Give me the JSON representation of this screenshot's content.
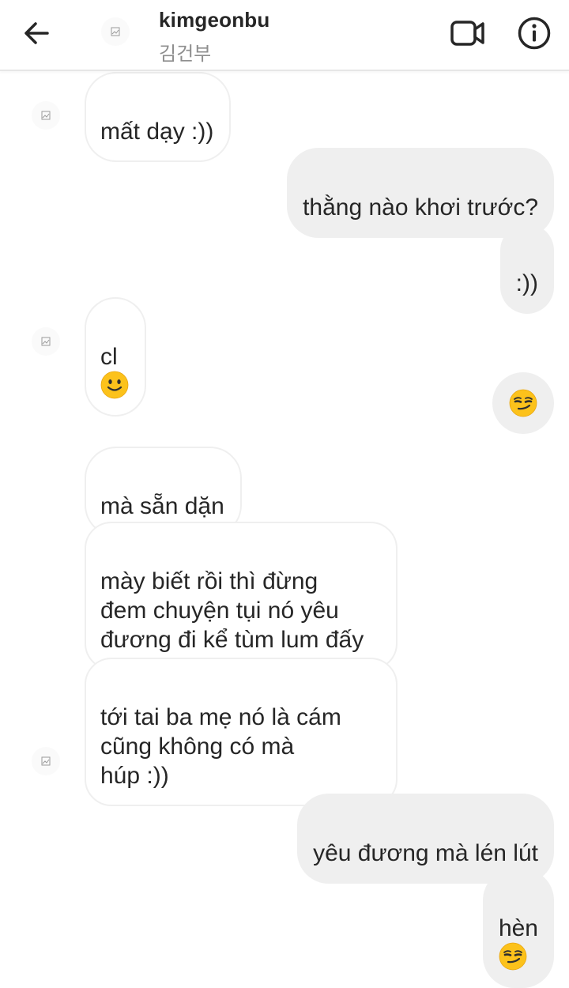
{
  "header": {
    "username": "kimgeonbu",
    "fullname": "김건부",
    "back_icon": "arrow-left-icon",
    "video_icon": "video-camera-icon",
    "info_icon": "info-circle-icon"
  },
  "messages": [
    {
      "from": "them",
      "text": "mất dạy :))"
    },
    {
      "from": "me",
      "text": "thằng nào khơi trước?"
    },
    {
      "from": "me",
      "text": ":))"
    },
    {
      "from": "them",
      "text": "cl",
      "emoji": "slightly-smiling-face"
    },
    {
      "from": "me",
      "text": "",
      "emoji": "smirking-face"
    },
    {
      "from": "them",
      "text": "mà sẵn dặn"
    },
    {
      "from": "them",
      "text": "mày biết rồi thì đừng\nđem chuyện tụi nó yêu\nđương đi kể tùm lum đấy"
    },
    {
      "from": "them",
      "text": "tới tai ba mẹ nó là cám\ncũng không có mà\nhúp :))"
    },
    {
      "from": "me",
      "text": "yêu đương mà lén lút"
    },
    {
      "from": "me",
      "text": "hèn",
      "emoji": "smirking-face"
    }
  ],
  "colors": {
    "sent_bubble": "#efefef",
    "received_border": "#efefef",
    "text": "#262626",
    "secondary_text": "#8e8e8e",
    "emoji_yellow": "#fcc21b"
  }
}
